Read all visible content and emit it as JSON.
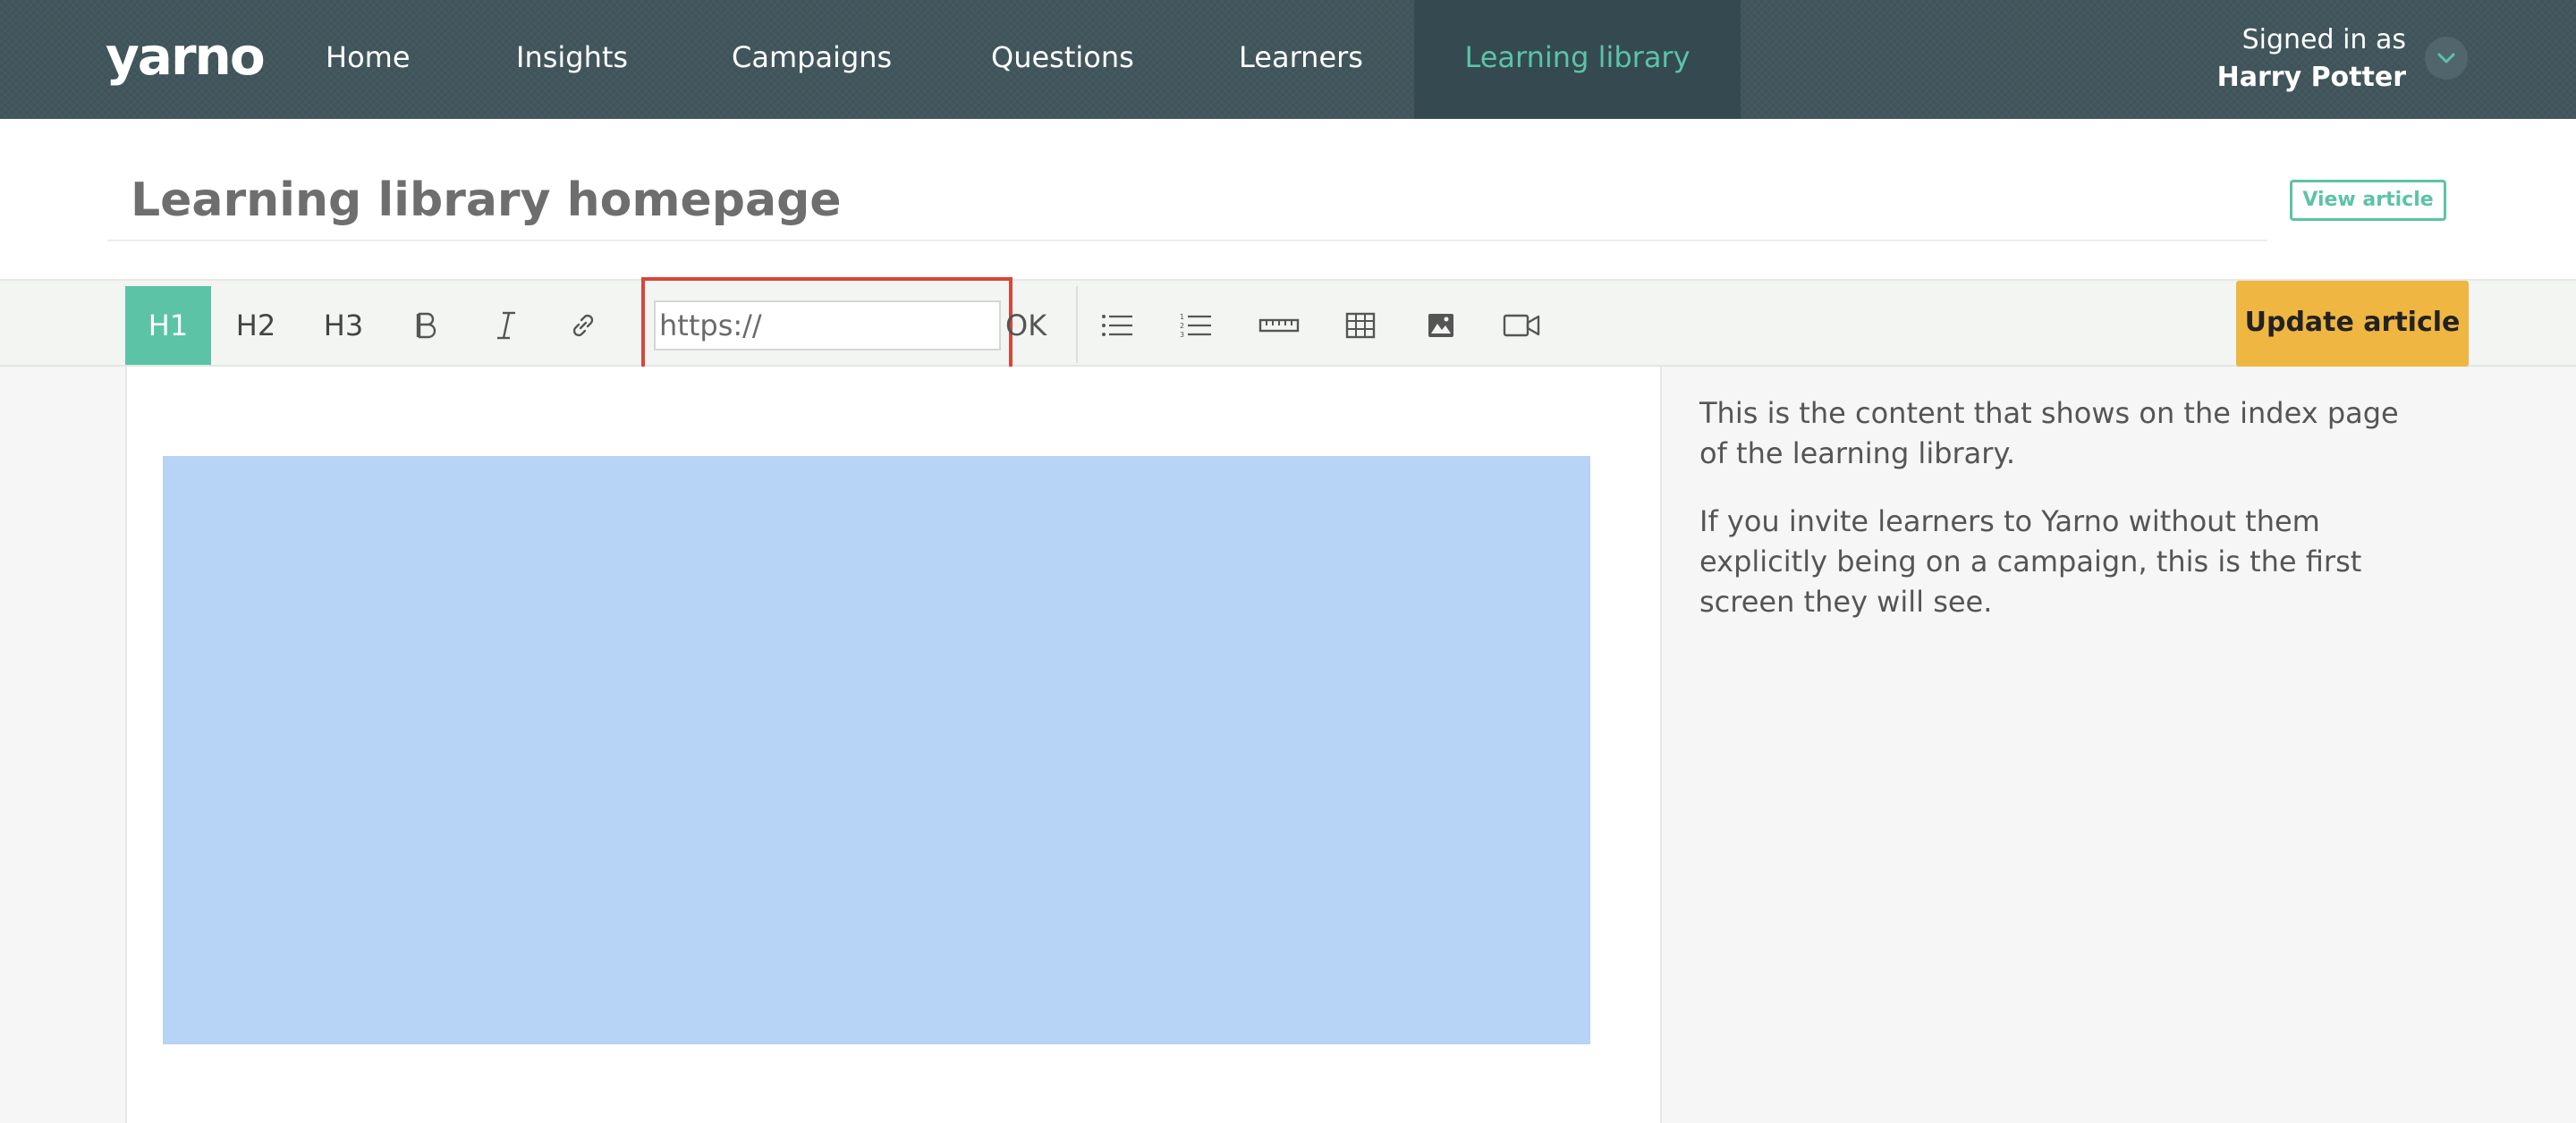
{
  "header": {
    "logo_text": "yarno",
    "nav": [
      {
        "label": "Home"
      },
      {
        "label": "Insights"
      },
      {
        "label": "Campaigns"
      },
      {
        "label": "Questions"
      },
      {
        "label": "Learners"
      },
      {
        "label": "Learning library",
        "active": true
      }
    ],
    "signed_in_label": "Signed in as",
    "user_name": "Harry Potter"
  },
  "page": {
    "title": "Learning library homepage",
    "view_article_label": "View article"
  },
  "toolbar": {
    "h1": "H1",
    "h2": "H2",
    "h3": "H3",
    "bold_icon": "bold-icon",
    "italic_icon": "italic-icon",
    "link_icon": "link-icon",
    "url_placeholder": "https://",
    "ok_label": "OK",
    "bullet_list_icon": "bullet-list-icon",
    "numbered_list_icon": "numbered-list-icon",
    "horizontal_rule_icon": "ruler-icon",
    "table_icon": "table-icon",
    "image_icon": "image-icon",
    "video_icon": "video-icon",
    "update_label": "Update article"
  },
  "help": {
    "paragraph_1": "This is the content that shows on the index page of the learning library.",
    "paragraph_2": "If you invite learners to Yarno without them explicitly being on a campaign, this is the first screen they will see."
  },
  "colors": {
    "nav_bg": "#3f545a",
    "accent": "#5cc3a7",
    "update_button": "#efb642",
    "highlight_border": "#d9453a",
    "image_placeholder": "#b7d3f6"
  }
}
